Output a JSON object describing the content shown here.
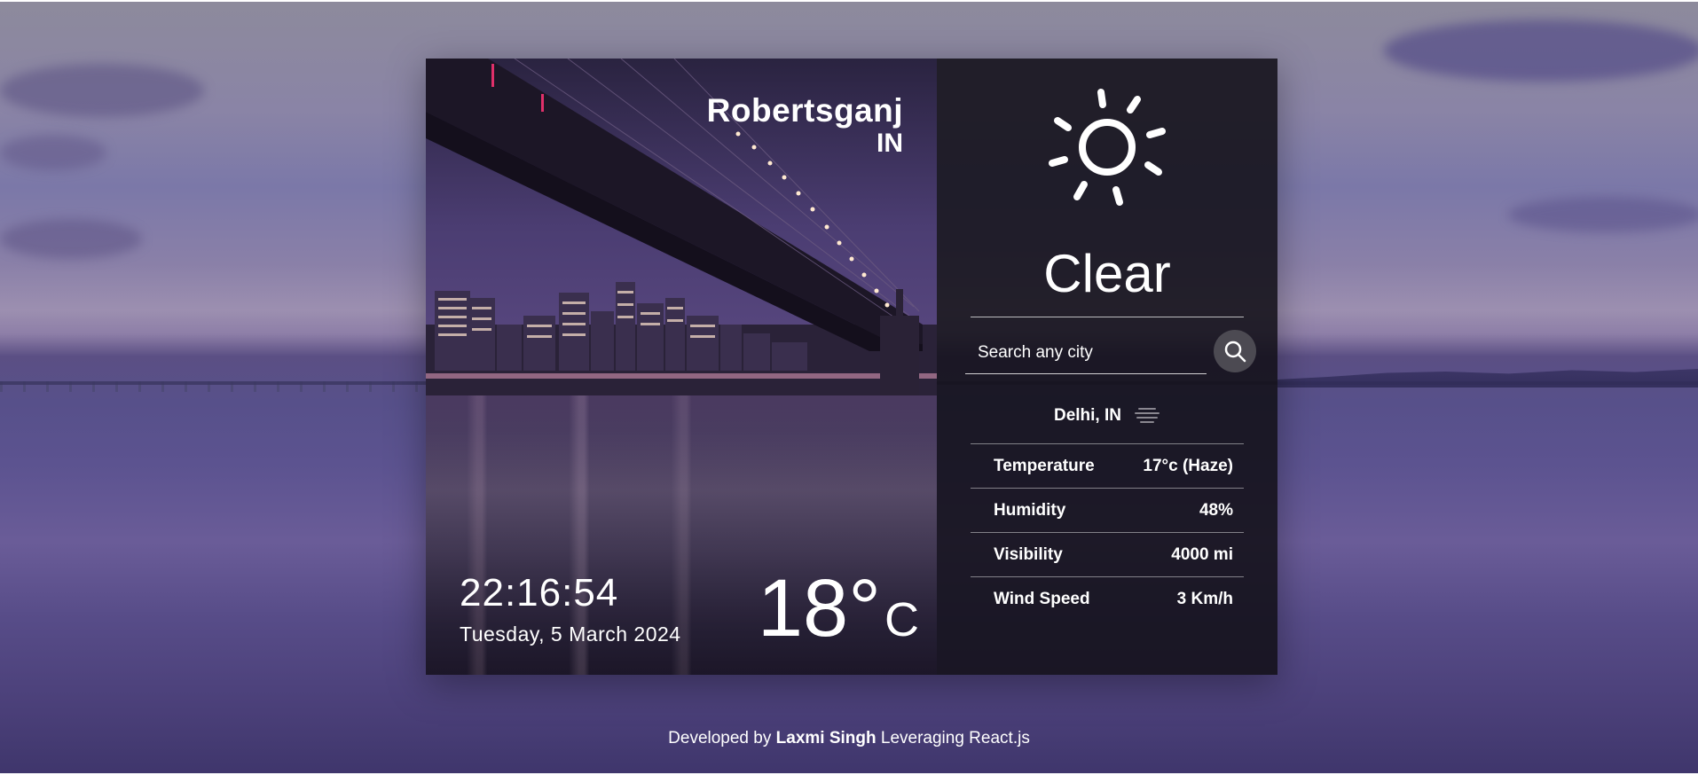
{
  "location": {
    "city": "Robertsganj",
    "country": "IN"
  },
  "clock": {
    "time": "22:16:54",
    "date": "Tuesday, 5 March 2024"
  },
  "current_temp": {
    "value": "18°",
    "unit": "C"
  },
  "weather": {
    "condition": "Clear",
    "icon": "sun-icon"
  },
  "search": {
    "placeholder": "Search any city",
    "value": "",
    "button_icon": "search-icon"
  },
  "result": {
    "city": "Delhi, IN",
    "icon": "haze-icon",
    "details": [
      {
        "label": "Temperature",
        "value": "17°c (Haze)"
      },
      {
        "label": "Humidity",
        "value": "48%"
      },
      {
        "label": "Visibility",
        "value": "4000 mi"
      },
      {
        "label": "Wind Speed",
        "value": "3 Km/h"
      }
    ]
  },
  "footer": {
    "prefix": "Developed by",
    "author": "Laxmi Singh",
    "suffix": "Leveraging React.js"
  }
}
